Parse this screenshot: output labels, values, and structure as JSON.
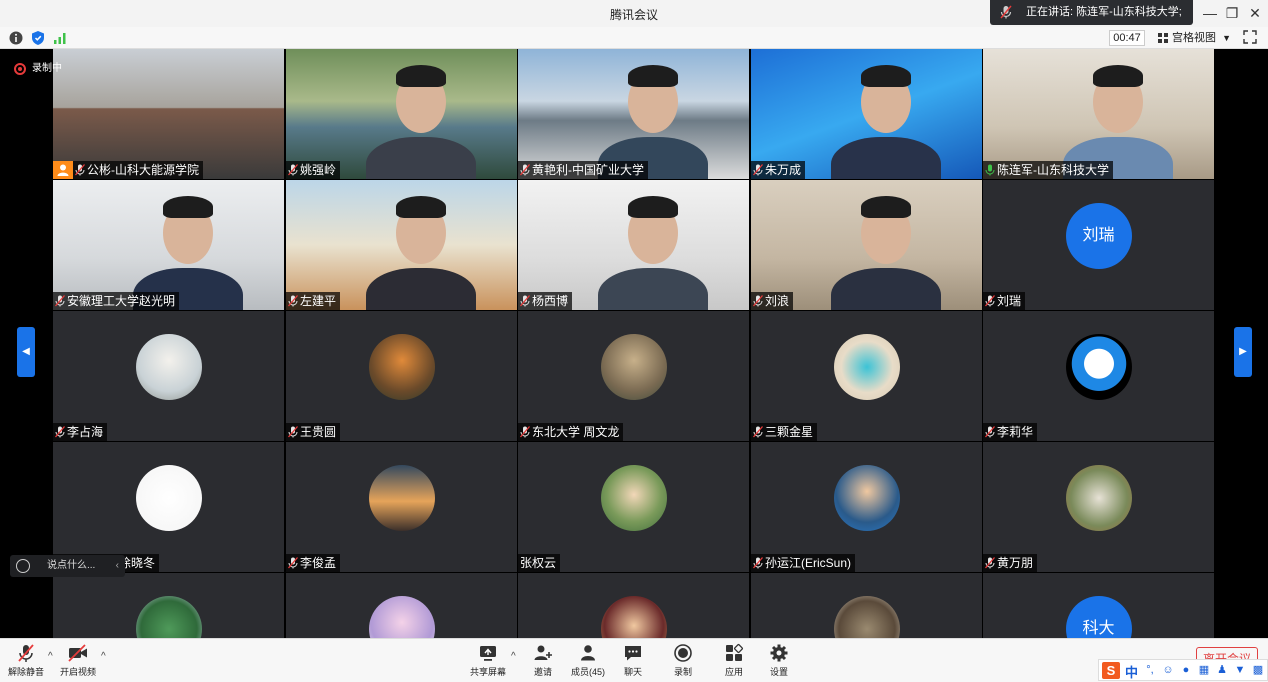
{
  "window": {
    "title": "腾讯会议",
    "speaking_text": "正在讲话: 陈连军-山东科技大学;",
    "minimize": "—",
    "restore": "❐",
    "close": "✕"
  },
  "infobar": {
    "timer": "00:47",
    "view_mode": "宫格视图"
  },
  "stage": {
    "recording_label": "录制中"
  },
  "tiles": [
    {
      "name": "公彬-山科大能源学院",
      "type": "video",
      "host": true
    },
    {
      "name": "姚强岭",
      "type": "video"
    },
    {
      "name": "黄艳利-中国矿业大学",
      "type": "video"
    },
    {
      "name": "朱万成",
      "type": "video"
    },
    {
      "name": "陈连军-山东科技大学",
      "type": "video",
      "speaking": true
    },
    {
      "name": "安徽理工大学赵光明",
      "type": "video"
    },
    {
      "name": "左建平",
      "type": "video"
    },
    {
      "name": "杨西博",
      "type": "video"
    },
    {
      "name": "刘浪",
      "type": "video"
    },
    {
      "name": "刘瑞",
      "type": "initials",
      "initials": "刘瑞"
    },
    {
      "name": "李占海",
      "type": "avatar"
    },
    {
      "name": "王贵圆",
      "type": "avatar"
    },
    {
      "name": "东北大学 周文龙",
      "type": "avatar"
    },
    {
      "name": "三颗金星",
      "type": "avatar"
    },
    {
      "name": "李莉华",
      "type": "avatar"
    },
    {
      "name": "东北大学-徐晓冬",
      "type": "avatar"
    },
    {
      "name": "李俊孟",
      "type": "avatar"
    },
    {
      "name": "张权云",
      "type": "avatar",
      "nomic": true
    },
    {
      "name": "孙运江(EricSun)",
      "type": "avatar"
    },
    {
      "name": "黄万朋",
      "type": "avatar"
    },
    {
      "name": "",
      "type": "avatar"
    },
    {
      "name": "",
      "type": "avatar"
    },
    {
      "name": "",
      "type": "avatar"
    },
    {
      "name": "",
      "type": "avatar"
    },
    {
      "name": "科大",
      "type": "initials",
      "initials": "科大"
    }
  ],
  "chat": {
    "placeholder": "说点什么..."
  },
  "toolbar": {
    "unmute": "解除静音",
    "start_video": "开启视频",
    "share_screen": "共享屏幕",
    "invite": "邀请",
    "members": "成员(45)",
    "chat": "聊天",
    "record": "录制",
    "apps": "应用",
    "settings": "设置",
    "leave": "离开会议"
  },
  "ime": {
    "logo": "S",
    "mode": "中"
  },
  "colors": {
    "accent": "#1a73e8",
    "tile_bg": "#2b2c30",
    "record_red": "#e63b3b",
    "host_orange": "#ff8c1a",
    "speaking_green": "#3fc24a"
  }
}
